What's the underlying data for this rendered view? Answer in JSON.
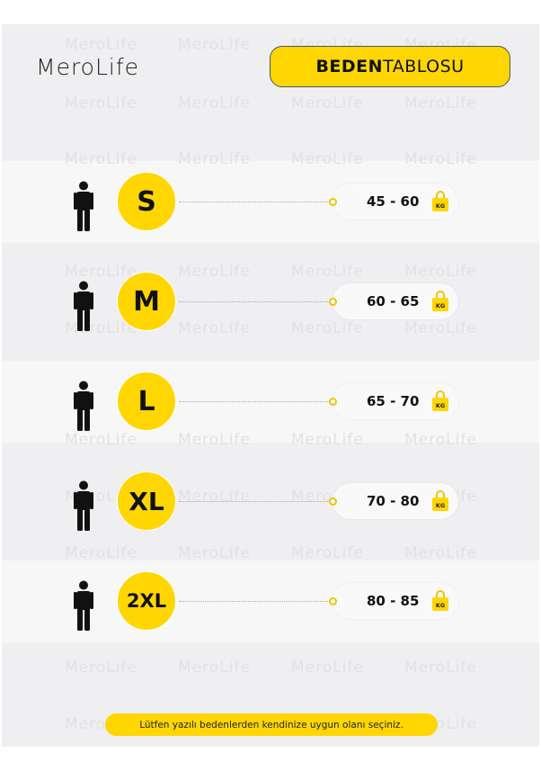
{
  "header": {
    "logo_text": "MeroLife",
    "title_bold": "BEDEN",
    "title_regular": "TABLOSU"
  },
  "watermark_text": "MeroLife",
  "sizes": [
    {
      "size": "S",
      "weight": "45 - 60",
      "unit": "KG"
    },
    {
      "size": "M",
      "weight": "60 - 65",
      "unit": "KG"
    },
    {
      "size": "L",
      "weight": "65 - 70",
      "unit": "KG"
    },
    {
      "size": "XL",
      "weight": "70 - 80",
      "unit": "KG"
    },
    {
      "size": "2XL",
      "weight": "80 - 85",
      "unit": "KG"
    }
  ],
  "footer": {
    "note": "Lütfen yazılı bedenlerden kendinize uygun olanı seçiniz."
  },
  "colors": {
    "accent_yellow": "#ffd600",
    "card_background": "#efeff1",
    "band_background": "#f7f7f8",
    "text_dark": "#111111"
  },
  "icons": {
    "person": "person-icon",
    "weight": "kg-weight-icon"
  }
}
